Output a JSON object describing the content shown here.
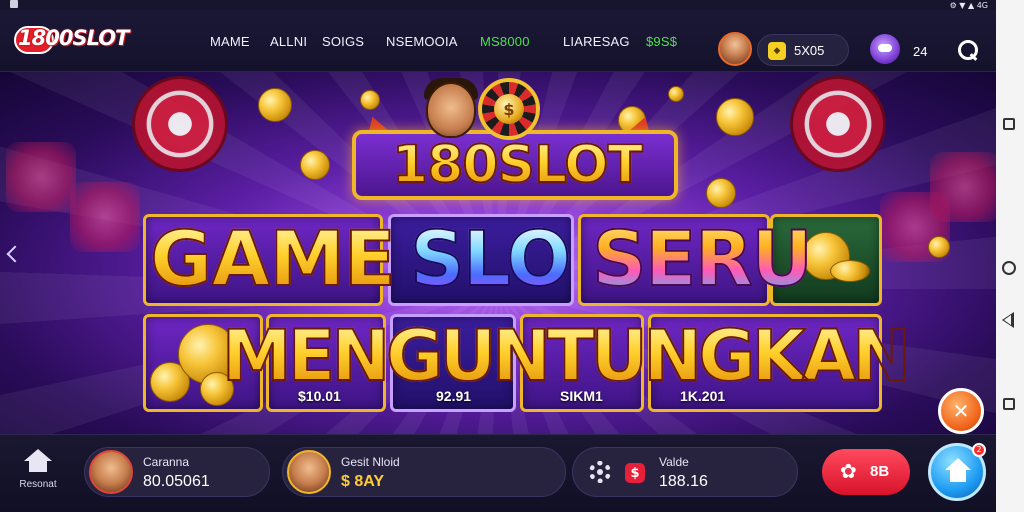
{
  "status": {
    "right_icons": "⚙ ▼ ▲ 4G"
  },
  "header": {
    "logo": "1800SLOT",
    "nav": [
      "MAME",
      "ALLNI",
      "SOIGS",
      "NSEMOOIA",
      "MS8000",
      "LIARESAG",
      "$9S$"
    ],
    "balance": "5X05",
    "count": "24"
  },
  "banner": {
    "title": "180SLOT",
    "line1_a": "GAME",
    "line1_b": "SLO",
    "line1_c": "SERU",
    "line2": "MENGUNTUNGKAN",
    "tile_values": [
      "$10.01",
      "92.91",
      "SIKM1",
      "1K.201"
    ]
  },
  "bottom": {
    "home_label": "Resonat",
    "card1": {
      "label": "Caranna",
      "value": "80.05061"
    },
    "card2": {
      "label": "Gesit Nloid",
      "value": "$ 8AY"
    },
    "card3": {
      "label": "Valde",
      "value": "188.16"
    },
    "red_button": "8B",
    "fab_badge": "2"
  },
  "colors": {
    "accent_red": "#e3202a",
    "gold": "#ffd02c",
    "purple": "#8f3fd8",
    "blue": "#1e8ef0"
  }
}
